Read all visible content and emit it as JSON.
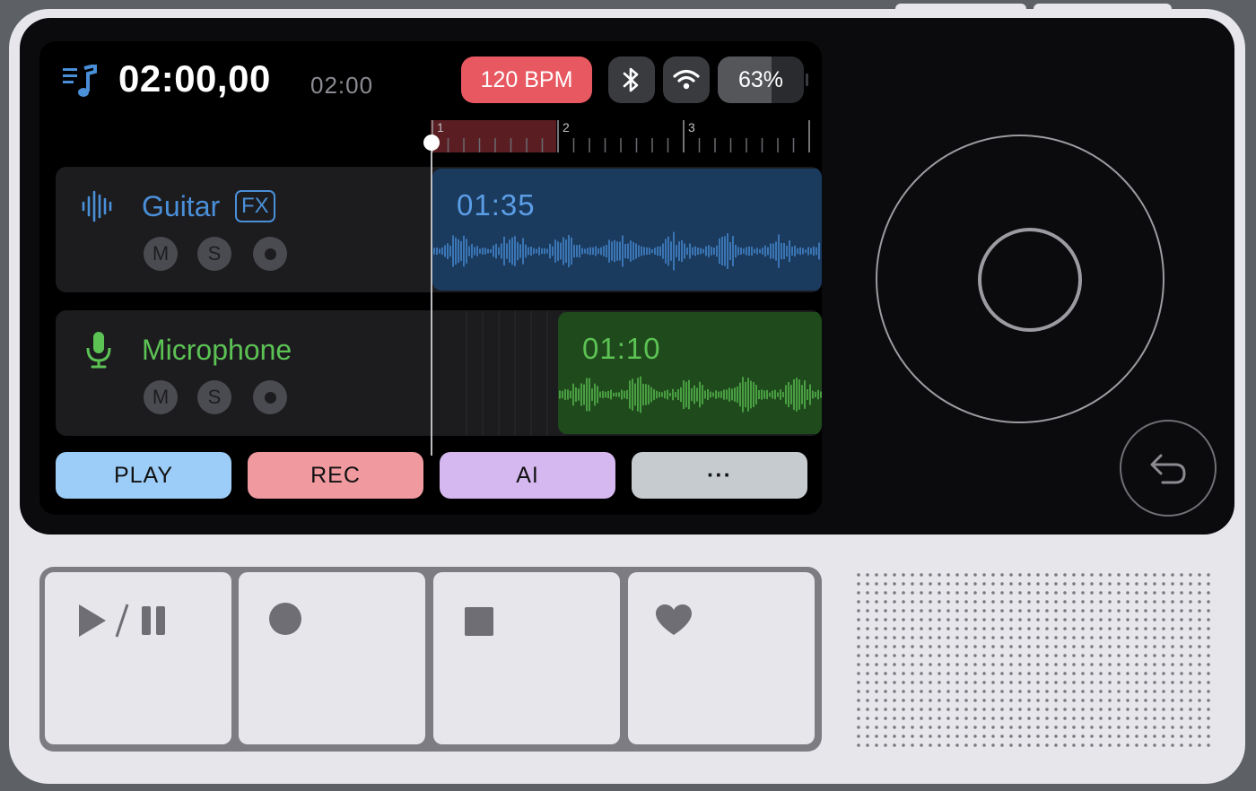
{
  "header": {
    "time_main": "02:00,00",
    "time_sub": "02:00",
    "bpm_label": "120 BPM",
    "battery_label": "63%",
    "battery_level": 0.63
  },
  "ruler": {
    "markers": [
      "1",
      "2",
      "3"
    ]
  },
  "tracks": [
    {
      "name": "Guitar",
      "fx_label": "FX",
      "clip_time": "01:35",
      "mute": "M",
      "solo": "S",
      "color": "#4a8fd8"
    },
    {
      "name": "Microphone",
      "clip_time": "01:10",
      "mute": "M",
      "solo": "S",
      "color": "#5cc254"
    }
  ],
  "actions": {
    "play": "PLAY",
    "rec": "REC",
    "ai": "AI",
    "more": "···"
  },
  "colors": {
    "bpm": "#e85860",
    "play": "#9ccdf8",
    "rec": "#f09aa0",
    "ai": "#d6b8f0",
    "more": "#c6cbd0",
    "guitar_clip": "#1a3a5e",
    "mic_clip": "#1f4a1c"
  },
  "icons": {
    "playlist": "music-list-icon",
    "guitar": "waveform-icon",
    "microphone": "microphone-icon",
    "bluetooth": "bluetooth-icon",
    "wifi": "wifi-icon",
    "undo": "undo-icon",
    "pad1": "play-pause-icon",
    "pad2": "record-icon",
    "pad3": "stop-icon",
    "pad4": "heart-icon"
  }
}
